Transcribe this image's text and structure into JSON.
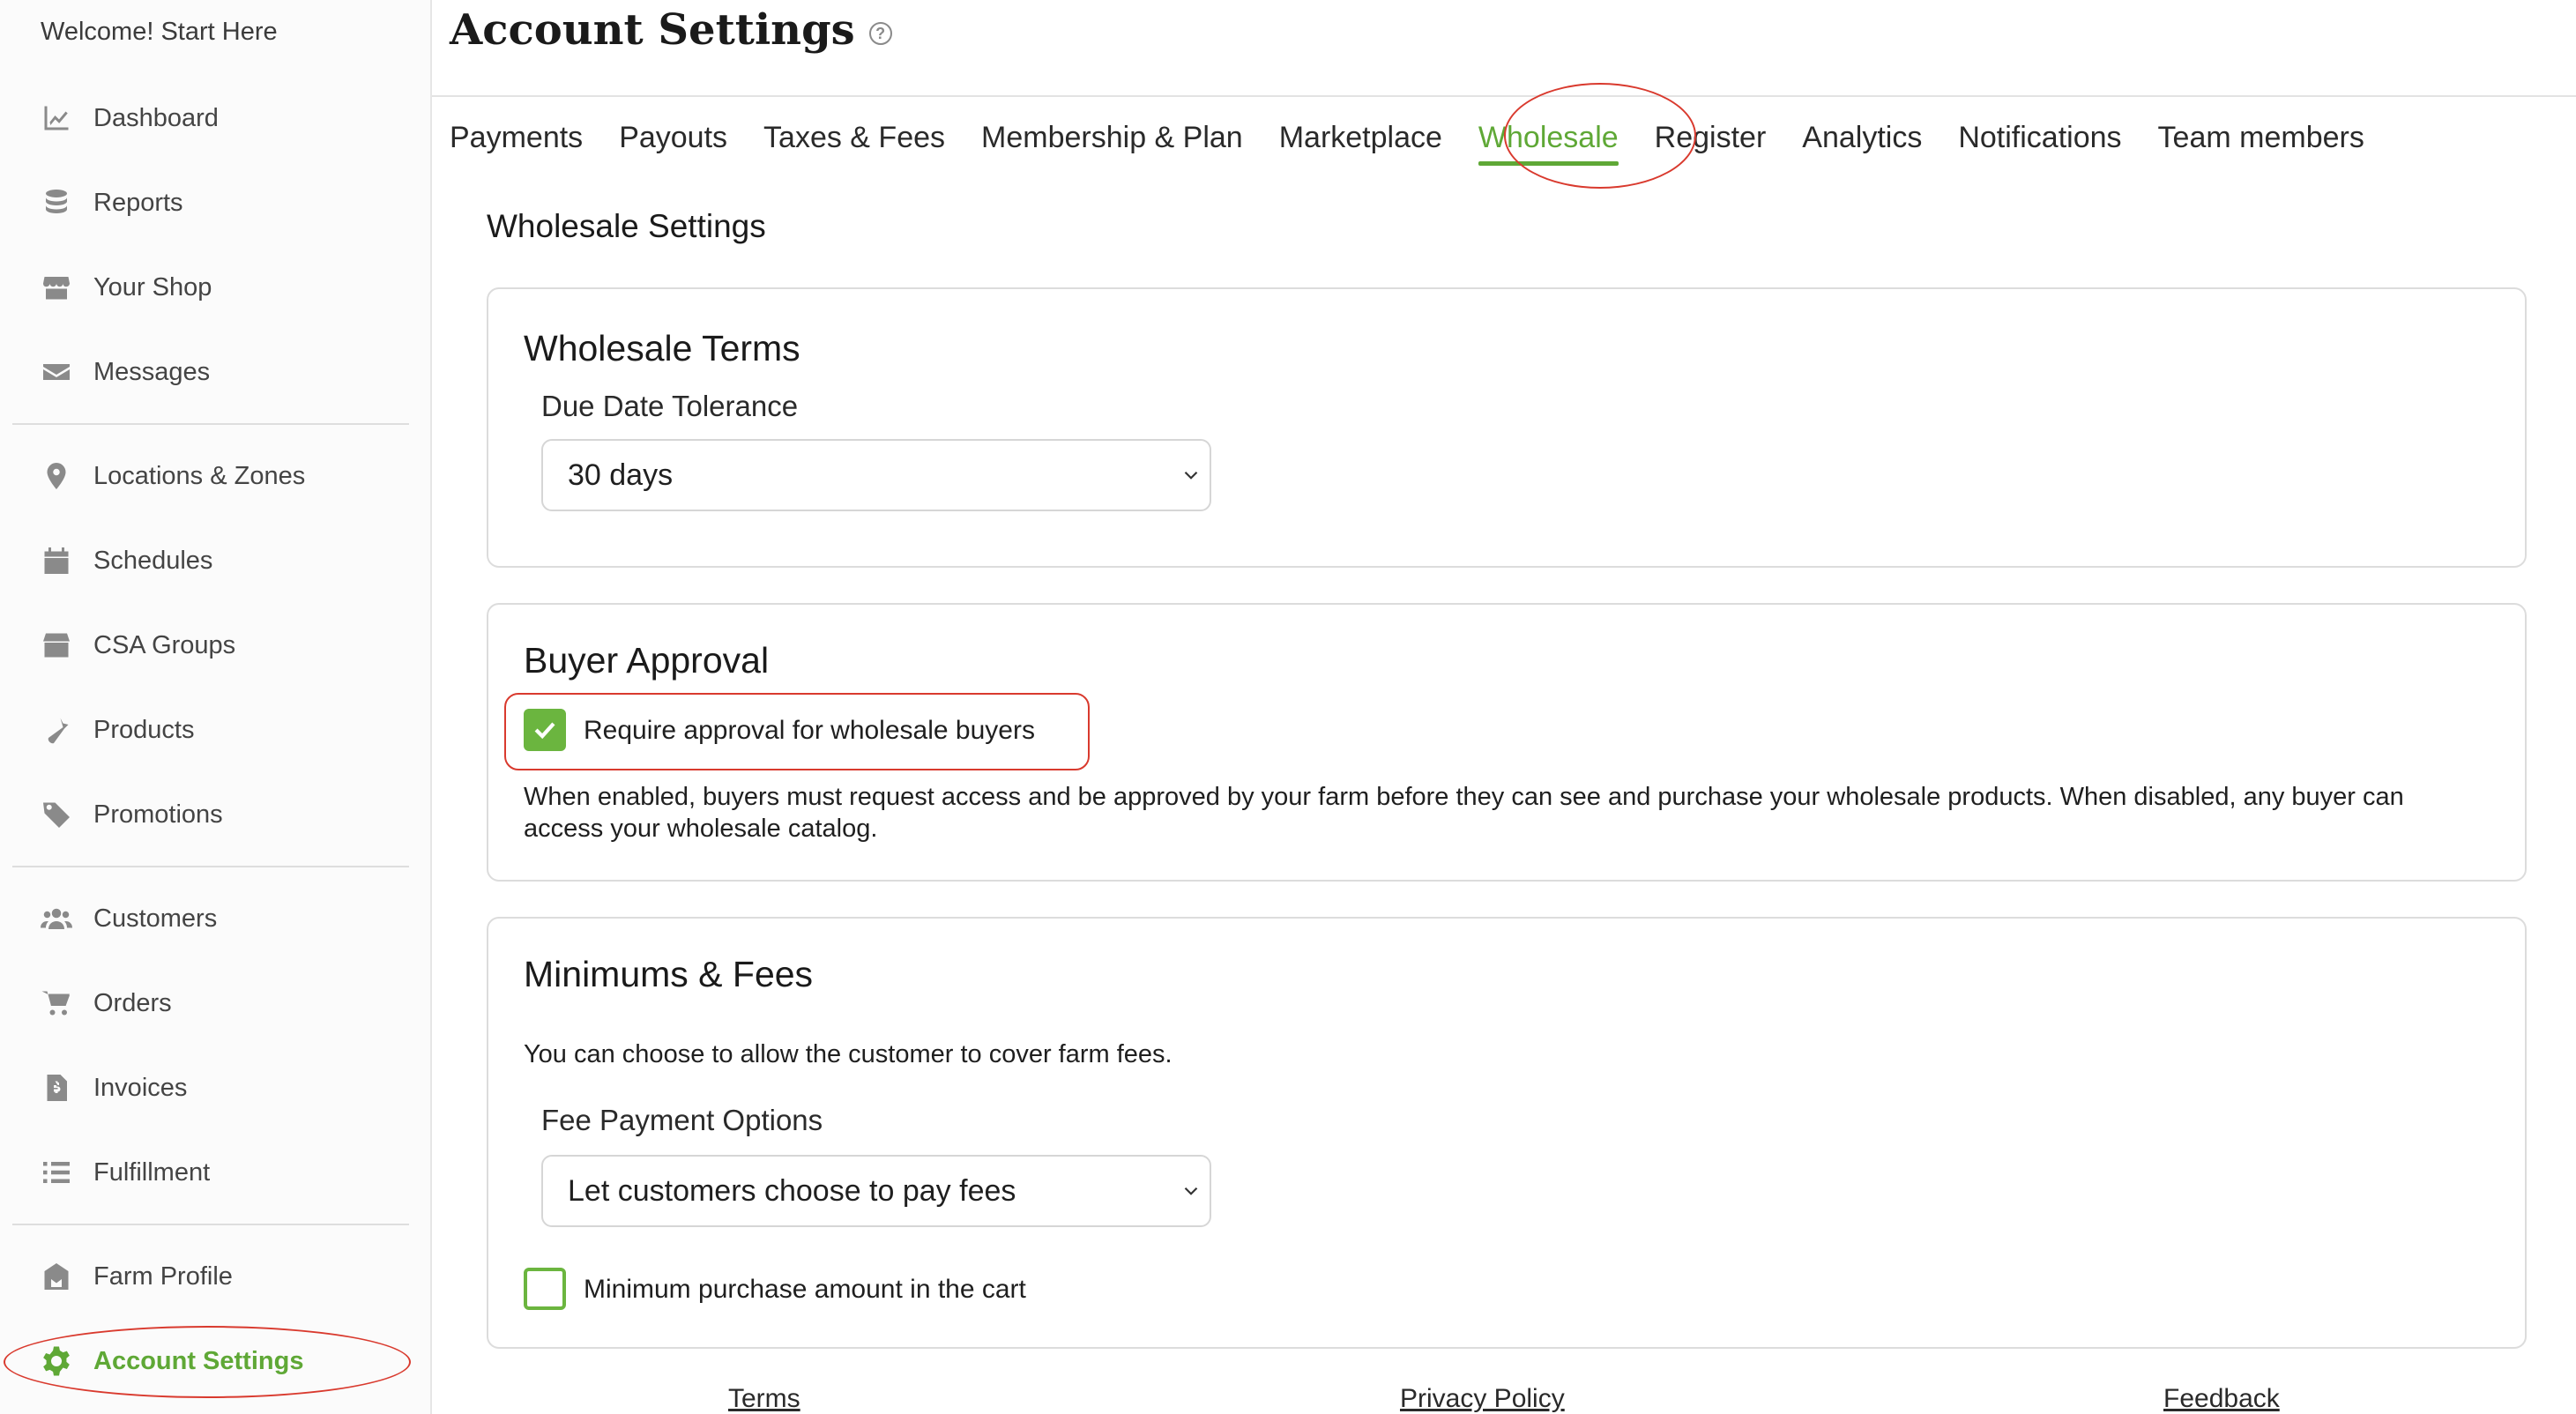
{
  "sidebar": {
    "welcome": "Welcome! Start Here",
    "items": [
      {
        "label": "Dashboard",
        "icon": "chart-line-icon"
      },
      {
        "label": "Reports",
        "icon": "coins-icon"
      },
      {
        "label": "Your Shop",
        "icon": "store-icon"
      },
      {
        "label": "Messages",
        "icon": "envelope-icon"
      },
      {
        "label": "Locations & Zones",
        "icon": "map-pin-icon"
      },
      {
        "label": "Schedules",
        "icon": "calendar-icon"
      },
      {
        "label": "CSA Groups",
        "icon": "box-icon"
      },
      {
        "label": "Products",
        "icon": "carrot-icon"
      },
      {
        "label": "Promotions",
        "icon": "tags-icon"
      },
      {
        "label": "Customers",
        "icon": "users-icon"
      },
      {
        "label": "Orders",
        "icon": "cart-icon"
      },
      {
        "label": "Invoices",
        "icon": "invoice-icon"
      },
      {
        "label": "Fulfillment",
        "icon": "list-icon"
      },
      {
        "label": "Farm Profile",
        "icon": "barn-icon"
      },
      {
        "label": "Account Settings",
        "icon": "gear-icon"
      }
    ],
    "active_item": "Account Settings"
  },
  "header": {
    "title": "Account Settings",
    "help_glyph": "?"
  },
  "tabs": [
    {
      "label": "Payments"
    },
    {
      "label": "Payouts"
    },
    {
      "label": "Taxes & Fees"
    },
    {
      "label": "Membership & Plan"
    },
    {
      "label": "Marketplace"
    },
    {
      "label": "Wholesale"
    },
    {
      "label": "Register"
    },
    {
      "label": "Analytics"
    },
    {
      "label": "Notifications"
    },
    {
      "label": "Team members"
    }
  ],
  "active_tab": "Wholesale",
  "main": {
    "section_title": "Wholesale Settings",
    "wholesale_terms": {
      "title": "Wholesale Terms",
      "due_date_label": "Due Date Tolerance",
      "due_date_value": "30 days"
    },
    "buyer_approval": {
      "title": "Buyer Approval",
      "checkbox_label": "Require approval for wholesale buyers",
      "checked": true,
      "description": "When enabled, buyers must request access and be approved by your farm before they can see and purchase your wholesale products. When disabled, any buyer can access your wholesale catalog."
    },
    "minimums_fees": {
      "title": "Minimums & Fees",
      "description": "You can choose to allow the customer to cover farm fees.",
      "fee_label": "Fee Payment Options",
      "fee_value": "Let customers choose to pay fees",
      "min_checkbox_label": "Minimum purchase amount in the cart",
      "min_checked": false
    }
  },
  "footer": {
    "terms": "Terms",
    "privacy": "Privacy Policy",
    "feedback": "Feedback"
  },
  "colors": {
    "accent": "#5fa836",
    "annotation": "#d93a2e"
  }
}
